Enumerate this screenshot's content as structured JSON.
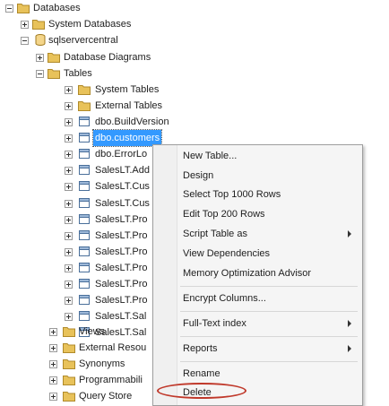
{
  "tree": {
    "databases": "Databases",
    "system_databases": "System Databases",
    "sqlservercentral": "sqlservercentral",
    "database_diagrams": "Database Diagrams",
    "tables": "Tables",
    "system_tables": "System Tables",
    "external_tables": "External Tables",
    "table_items": [
      "dbo.BuildVersion",
      "dbo.customers",
      "dbo.ErrorLo",
      "SalesLT.Add",
      "SalesLT.Cus",
      "SalesLT.Cus",
      "SalesLT.Pro",
      "SalesLT.Pro",
      "SalesLT.Pro",
      "SalesLT.Pro",
      "SalesLT.Pro",
      "SalesLT.Pro",
      "SalesLT.Sal",
      "SalesLT.Sal"
    ],
    "views": "Views",
    "external_resources": "External Resou",
    "synonyms": "Synonyms",
    "programmability": "Programmabili",
    "query_store": "Query Store"
  },
  "menu": {
    "new_table": "New Table...",
    "design": "Design",
    "select_top": "Select Top 1000 Rows",
    "edit_top": "Edit Top 200 Rows",
    "script_table_as": "Script Table as",
    "view_dependencies": "View Dependencies",
    "memory_optimization": "Memory Optimization Advisor",
    "encrypt_columns": "Encrypt Columns...",
    "full_text_index": "Full-Text index",
    "reports": "Reports",
    "rename": "Rename",
    "delete": "Delete"
  },
  "colors": {
    "folder": "#e8c25a",
    "selection": "#3399ff",
    "highlight_oval": "#c0392b"
  }
}
